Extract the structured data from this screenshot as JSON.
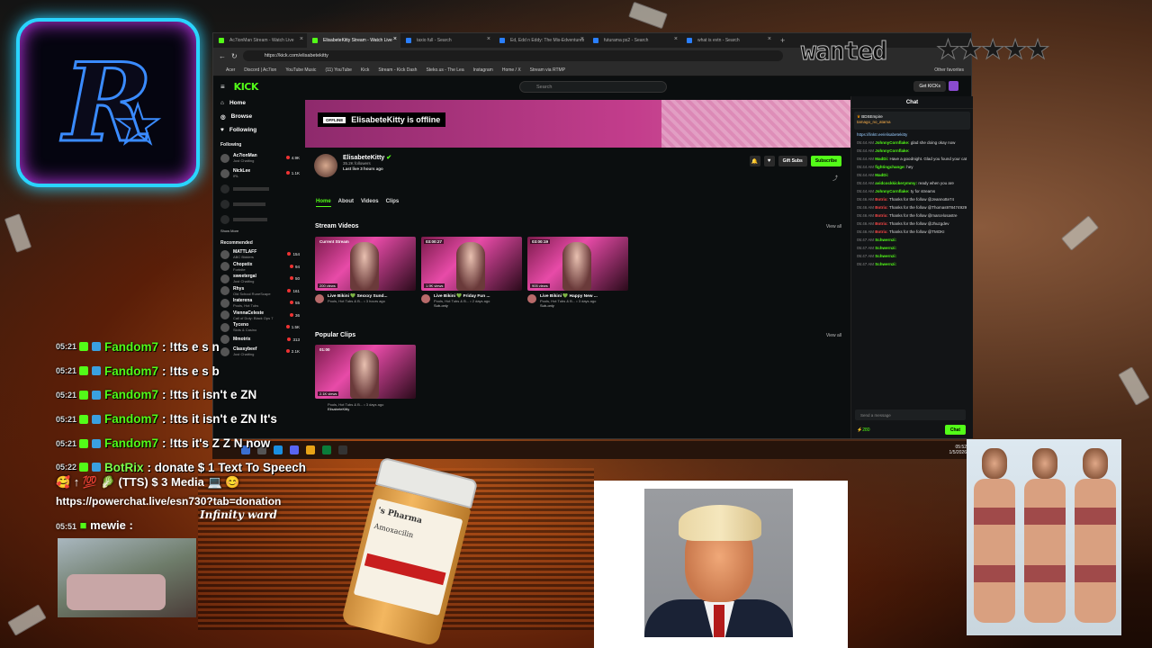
{
  "browser": {
    "tabs": [
      "Ac7ionMan Stream - Watch Live",
      "ElisabeteKitty Stream - Watch Live",
      "taxio full - Search",
      "Ed, Edd n Eddy: The Mis-Edventures",
      "futurama ps2 - Search",
      "what is evtn - Search"
    ],
    "url": "https://kick.com/elisabetekitty",
    "bookmarks": [
      "Acer",
      "Discord | Ac7ion",
      "YouTube Music",
      "(11) YouTube",
      "Kick",
      "Stream - Kick Dash",
      "Steko.us - The Lea",
      "Instagram",
      "Home / X",
      "Stream via RTMP",
      "Other favorites"
    ]
  },
  "kick": {
    "logo": "KICK",
    "search_placeholder": "Search",
    "get_kicks": "Get KICKs",
    "nav": [
      {
        "label": "Home",
        "icon": "home-icon"
      },
      {
        "label": "Browse",
        "icon": "compass-icon"
      },
      {
        "label": "Following",
        "icon": "heart-icon"
      }
    ],
    "following_title": "Following",
    "following": [
      {
        "name": "Ac7ionMan",
        "sub": "Just Chatting",
        "viewers": "4.9K",
        "online": true
      },
      {
        "name": "NickLee",
        "sub": "IRL",
        "viewers": "1.1K",
        "online": true
      },
      {
        "name": "",
        "sub": "",
        "viewers": "",
        "online": false
      },
      {
        "name": "",
        "sub": "",
        "viewers": "",
        "online": false
      },
      {
        "name": "",
        "sub": "",
        "viewers": "",
        "online": false
      }
    ],
    "show_more": "Show More",
    "recommended_title": "Recommended",
    "recommended": [
      {
        "name": "MATTLAFF",
        "sub": "ABC Bidders",
        "viewers": "154"
      },
      {
        "name": "Chopstix",
        "sub": "Fortnite",
        "viewers": "94"
      },
      {
        "name": "sweetergal",
        "sub": "Just Chatting",
        "viewers": "50"
      },
      {
        "name": "Rhys",
        "sub": "Old School RuneScape",
        "viewers": "161"
      },
      {
        "name": "Iraterena",
        "sub": "Pools, Hot Tubs",
        "viewers": "55"
      },
      {
        "name": "ViennaCeleste",
        "sub": "Call of Duty: Black Ops 7",
        "viewers": "36"
      },
      {
        "name": "Tyceno",
        "sub": "Slots & Casino",
        "viewers": "1.5K"
      },
      {
        "name": "Mmotrix",
        "sub": "",
        "viewers": "313"
      },
      {
        "name": "Classybeef",
        "sub": "Just Chatting",
        "viewers": "2.1K"
      }
    ],
    "banner": {
      "badge": "OFFLINE",
      "text": "ElisabeteKitty is offline"
    },
    "channel": {
      "name": "ElisabeteKitty",
      "followers": "35.2K followers",
      "last_live": "Last live 3 hours ago"
    },
    "actions": {
      "gift": "Gift Subs",
      "subscribe": "Subscribe"
    },
    "profile_tabs": [
      "Home",
      "About",
      "Videos",
      "Clips"
    ],
    "stream_videos_title": "Stream Videos",
    "view_all": "View all",
    "videos": [
      {
        "label": "Current Stream",
        "views": "200 views",
        "title": "Live Bikini 💚 Sexxxy Sund...",
        "meta": "Pools, Hot Tubs & B... • 3 hours ago",
        "sub": ""
      },
      {
        "label": "03:00:27",
        "views": "1.9K views",
        "title": "Live Bikini 💚 Friday Fun ...",
        "meta": "Pools, Hot Tubs & B... • 2 days ago",
        "sub": "Sub-only"
      },
      {
        "label": "03:00:19",
        "views": "905 views",
        "title": "Live Bikini 💚 Happy New ...",
        "meta": "Pools, Hot Tubs & B... • 3 days ago",
        "sub": "Sub-only"
      }
    ],
    "clips_title": "Popular Clips",
    "clip": {
      "label": "01:00",
      "views": "2.1K views",
      "meta": "Pools, Hot Tubs & B... • 3 days ago",
      "author": "ElisabeteKitty"
    },
    "chat": {
      "title": "Chat",
      "pinned_user": "BDSEmpire",
      "pinned_sub": "tamago_no_atama",
      "pinned_link": "https://linktr.ee/elisabetekitty",
      "messages": [
        {
          "t": "05:44 AM",
          "u": "JohnnyCornflake:",
          "m": "glad she doing okay now"
        },
        {
          "t": "05:44 AM",
          "u": "JohnnyCornflake:",
          "m": ""
        },
        {
          "t": "05:44 AM",
          "u": "MadDi:",
          "m": "Have a goodnight. Glad you found your cat"
        },
        {
          "t": "05:44 AM",
          "u": "fightingchange:",
          "m": "hey"
        },
        {
          "t": "05:44 AM",
          "u": "MadDi:",
          "m": ""
        },
        {
          "t": "05:44 AM",
          "u": "avidcockkickerymmy:",
          "m": "ready when you are"
        },
        {
          "t": "05:44 AM",
          "u": "JohnnyCornflake:",
          "m": "ty for streams"
        },
        {
          "t": "05:46 AM",
          "u": "Botrix:",
          "m": "Thanks for the follow @Jeannotte74"
        },
        {
          "t": "05:46 AM",
          "u": "Botrix:",
          "m": "Thanks for the follow @Thomas978474929"
        },
        {
          "t": "05:46 AM",
          "u": "Botrix:",
          "m": "Thanks for the follow @marcelosastre"
        },
        {
          "t": "05:46 AM",
          "u": "Botrix:",
          "m": "Thanks for the follow @Jhuzgdev"
        },
        {
          "t": "05:46 AM",
          "u": "Botrix:",
          "m": "Thanks for the follow @TMOKI"
        },
        {
          "t": "05:47 AM",
          "u": "Schwernzi:",
          "m": ""
        },
        {
          "t": "05:47 AM",
          "u": "Schwernzi:",
          "m": ""
        },
        {
          "t": "05:47 AM",
          "u": "Schwernzi:",
          "m": ""
        },
        {
          "t": "05:47 AM",
          "u": "Schwernzi:",
          "m": ""
        }
      ],
      "input_placeholder": "Send a message",
      "points": "280",
      "send": "Chat"
    }
  },
  "taskbar": {
    "time": "05:52",
    "date": "1/5/2026"
  },
  "overlay": {
    "wanted": "wanted",
    "stars": "★★★★★",
    "twitch_lines": [
      {
        "ts": "05:21",
        "user": "Fandom7",
        "msg": ": !tts e s n"
      },
      {
        "ts": "05:21",
        "user": "Fandom7",
        "msg": ": !tts e s b"
      },
      {
        "ts": "05:21",
        "user": "Fandom7",
        "msg": ": !tts it isn't e ZN"
      },
      {
        "ts": "05:21",
        "user": "Fandom7",
        "msg": ": !tts it isn't e ZN It's"
      },
      {
        "ts": "05:21",
        "user": "Fandom7",
        "msg": ": !tts it's Z Z N now"
      },
      {
        "ts": "05:22",
        "user": "BotRix",
        "msg": ": donate  $  1 Text To Speech"
      }
    ],
    "donate_line": "🥰 ↑ 💯 🥬 (TTS)  $  3 Media  💻 😊",
    "power_url": "https://powerchat.live/esn730?tab=donation",
    "infinity_ward": "Infinity ward",
    "mewie_ts": "05:51",
    "mewie": "mewie :",
    "pill_label": "Amoxacilin",
    "pill_brand": "'s Pharma"
  }
}
